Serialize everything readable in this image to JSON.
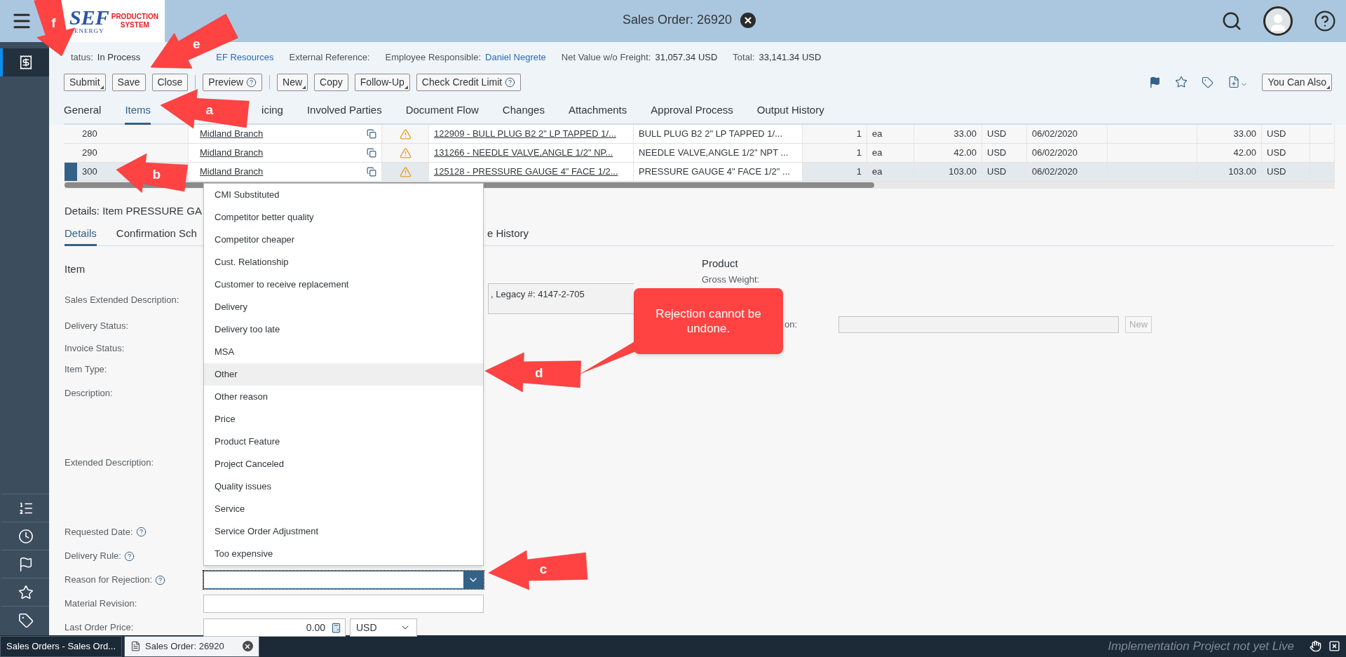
{
  "shell": {
    "title": "Sales Order: 26920",
    "logo": {
      "brand": "SEF",
      "sub": "ENERGY",
      "tagline": [
        "PRODUCTION",
        "SYSTEM"
      ]
    }
  },
  "side_nav": {
    "items": [
      {
        "selected": true
      },
      {
        "selected": false
      },
      {
        "selected": false
      },
      {
        "selected": false
      },
      {
        "selected": false
      },
      {
        "selected": false
      }
    ]
  },
  "header_fields": [
    {
      "label": "tatus:",
      "value": "In Process",
      "kind": "text"
    },
    {
      "value": "EF Resources",
      "kind": "link"
    },
    {
      "label": "External Reference:"
    },
    {
      "label": "Employee Responsible:",
      "value": "Daniel Negrete",
      "kind": "link"
    },
    {
      "label": "Net Value w/o Freight:",
      "value": "31,057.34 USD",
      "kind": "text"
    },
    {
      "label": "Total:",
      "value": "33,141.34 USD",
      "kind": "text"
    }
  ],
  "toolbar": {
    "groups": [
      [
        {
          "label": "Submit",
          "kind": "menu"
        },
        {
          "label": "Save",
          "kind": "plain"
        },
        {
          "label": "Close",
          "kind": "plain"
        }
      ],
      [
        {
          "label": "Preview",
          "kind": "help"
        }
      ],
      [
        {
          "label": "New",
          "kind": "menu"
        },
        {
          "label": "Copy",
          "kind": "plain"
        },
        {
          "label": "Follow-Up",
          "kind": "menu"
        },
        {
          "label": "Check Credit Limit",
          "kind": "help"
        }
      ]
    ],
    "right_button": {
      "label": "You Can Also",
      "kind": "menu"
    }
  },
  "tabs": [
    {
      "label": "General",
      "selected": false
    },
    {
      "label": "Items",
      "selected": true
    },
    {
      "label": "icing",
      "selected": false
    },
    {
      "label": "Involved Parties",
      "selected": false
    },
    {
      "label": "Document Flow",
      "selected": false
    },
    {
      "label": "Changes",
      "selected": false
    },
    {
      "label": "Attachments",
      "selected": false
    },
    {
      "label": "Approval Process",
      "selected": false
    },
    {
      "label": "Output History",
      "selected": false
    }
  ],
  "table": {
    "rows": [
      {
        "item": "280",
        "branch": "Midland Branch",
        "product": "122909 - BULL PLUG B2 2\" LP TAPPED 1/...",
        "description": "BULL PLUG B2 2\" LP TAPPED 1/...",
        "qty": "1",
        "unit": "ea",
        "price": "33.00",
        "currency": "USD",
        "date": "06/02/2020",
        "net": "33.00",
        "net_currency": "USD",
        "selected": false
      },
      {
        "item": "290",
        "branch": "Midland Branch",
        "product": "131266 - NEEDLE VALVE,ANGLE 1/2\" NP...",
        "description": "NEEDLE VALVE,ANGLE 1/2\" NPT ...",
        "qty": "1",
        "unit": "ea",
        "price": "42.00",
        "currency": "USD",
        "date": "06/02/2020",
        "net": "42.00",
        "net_currency": "USD",
        "selected": false
      },
      {
        "item": "300",
        "branch": "Midland Branch",
        "product": "125128 - PRESSURE GAUGE 4\" FACE 1/2...",
        "description": "PRESSURE GAUGE 4\" FACE 1/2\" ...",
        "qty": "1",
        "unit": "ea",
        "price": "103.00",
        "currency": "USD",
        "date": "06/02/2020",
        "net": "103.00",
        "net_currency": "USD",
        "selected": true
      }
    ]
  },
  "details": {
    "title": "Details: Item PRESSURE GA",
    "tabs": [
      {
        "label": "Details",
        "selected": true
      },
      {
        "label": "Confirmation Sch",
        "selected": false
      },
      {
        "label": "e History",
        "selected": false
      }
    ],
    "rows": [
      {
        "label": "Item",
        "kind": "heading",
        "help": false
      },
      {
        "label": "Sales Extended Description:",
        "kind": "label",
        "help": false
      },
      {
        "label": "Delivery Status:",
        "kind": "label",
        "help": false
      },
      {
        "label": "Invoice Status:",
        "kind": "label",
        "help": false
      },
      {
        "label": "Item Type:",
        "kind": "label",
        "help": false
      },
      {
        "label": "Description:",
        "kind": "label",
        "help": false
      },
      {
        "label": "Extended Description:",
        "kind": "label",
        "help": false
      },
      {
        "label": "Requested Date:",
        "kind": "label",
        "help": true
      },
      {
        "label": "Delivery Rule:",
        "kind": "label",
        "help": true
      },
      {
        "label": "Reason for Rejection:",
        "kind": "label",
        "help": true,
        "field": {
          "kind": "select",
          "focused": true
        }
      },
      {
        "label": "Material Revision:",
        "kind": "label",
        "help": false,
        "field": {
          "kind": "input",
          "focused": false
        }
      },
      {
        "label": "Last Order Price:",
        "kind": "label",
        "help": false,
        "field": {
          "kind": "amount",
          "value": "0.00",
          "currency": "USD",
          "focused": false
        }
      }
    ],
    "legacy_field": {
      "value": ", Legacy #: 4147-2-705"
    },
    "product": {
      "heading": "Product",
      "gross_weight_label": "Gross Weight:",
      "field_label": "on:",
      "button": {
        "label": "New",
        "disabled": true
      }
    }
  },
  "reason_options": [
    {
      "label": "CMI Substituted",
      "highlighted": false
    },
    {
      "label": "Competitor better quality",
      "highlighted": false
    },
    {
      "label": "Competitor cheaper",
      "highlighted": false
    },
    {
      "label": "Cust. Relationship",
      "highlighted": false
    },
    {
      "label": "Customer to receive replacement",
      "highlighted": false
    },
    {
      "label": "Delivery",
      "highlighted": false
    },
    {
      "label": "Delivery too late",
      "highlighted": false
    },
    {
      "label": "MSA",
      "highlighted": false
    },
    {
      "label": "Other",
      "highlighted": true
    },
    {
      "label": "Other reason",
      "highlighted": false
    },
    {
      "label": "Price",
      "highlighted": false
    },
    {
      "label": "Product Feature",
      "highlighted": false
    },
    {
      "label": "Project Canceled",
      "highlighted": false
    },
    {
      "label": "Quality issues",
      "highlighted": false
    },
    {
      "label": "Service",
      "highlighted": false
    },
    {
      "label": "Service Order Adjustment",
      "highlighted": false
    },
    {
      "label": "Too expensive",
      "highlighted": false
    }
  ],
  "annotations": {
    "arrows": [
      {
        "label": "a"
      },
      {
        "label": "b"
      },
      {
        "label": "c"
      },
      {
        "label": "d"
      },
      {
        "label": "e"
      },
      {
        "label": "f"
      }
    ],
    "callout": "Rejection cannot be undone."
  },
  "taskbar": {
    "tabs": [
      {
        "label": "Sales Orders - Sales Ord...",
        "selected": false
      },
      {
        "label": "Sales Order: 26920",
        "selected": true
      }
    ],
    "notice": "Implementation Project not yet Live"
  }
}
